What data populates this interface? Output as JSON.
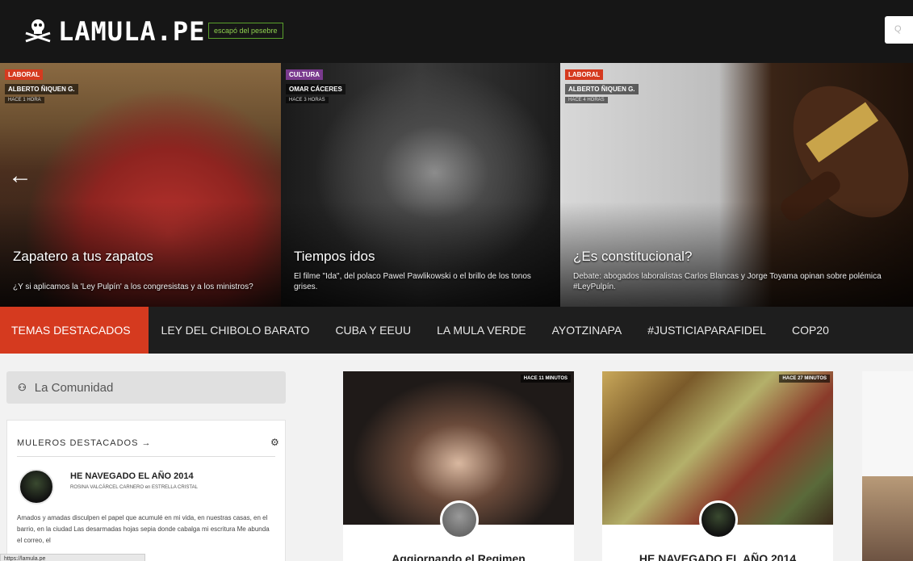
{
  "header": {
    "logo": "LAMULA.PE",
    "tagline": "escapó del pesebre",
    "search_placeholder": "Q"
  },
  "hero_slides": [
    {
      "category": "LABORAL",
      "author": "ALBERTO ÑIQUEN G.",
      "time": "HACE 1 HORA",
      "title": "Zapatero a tus zapatos",
      "subtitle": "¿Y si aplicamos la 'Ley Pulpín' a los congresistas y a los ministros?"
    },
    {
      "category": "CULTURA",
      "author": "OMAR CÁCERES",
      "time": "HACE 3 HORAS",
      "title": "Tiempos idos",
      "subtitle": "El filme \"Ida\", del polaco Pawel Pawlikowski o el brillo de los tonos grises."
    },
    {
      "category": "LABORAL",
      "author": "ALBERTO ÑIQUEN G.",
      "time": "HACE 4 HORAS",
      "title": "¿Es constitucional?",
      "subtitle": "Debate: abogados laboralistas Carlos Blancas y Jorge Toyama opinan sobre polémica #LeyPulpín."
    }
  ],
  "topics": {
    "active": "TEMAS DESTACADOS",
    "items": [
      "LEY DEL CHIBOLO BARATO",
      "CUBA Y EEUU",
      "LA MULA VERDE",
      "AYOTZINAPA",
      "#JUSTICIAPARAFIDEL",
      "COP20"
    ]
  },
  "community": {
    "label": "La Comunidad",
    "section_title": "MULEROS DESTACADOS →",
    "post_title": "HE NAVEGADO EL AÑO 2014",
    "post_meta": "ROSINA VALCÁRCEL CARNERO en ESTRELLA CRISTAL",
    "excerpt": "Amados y amadas disculpen el papel que acumulé en mi vida, en nuestras casas, en el barrio, en la ciudad Las desarmadas hojas sepia donde cabalga mi escritura Me abunda el correo, el"
  },
  "cards": [
    {
      "time": "HACE 11 MINUTOS",
      "title": "Aggiornando el Regimen"
    },
    {
      "time": "HACE 27 MINUTOS",
      "title": "HE NAVEGADO EL AÑO 2014"
    }
  ],
  "status_url": "https://lamula.pe"
}
